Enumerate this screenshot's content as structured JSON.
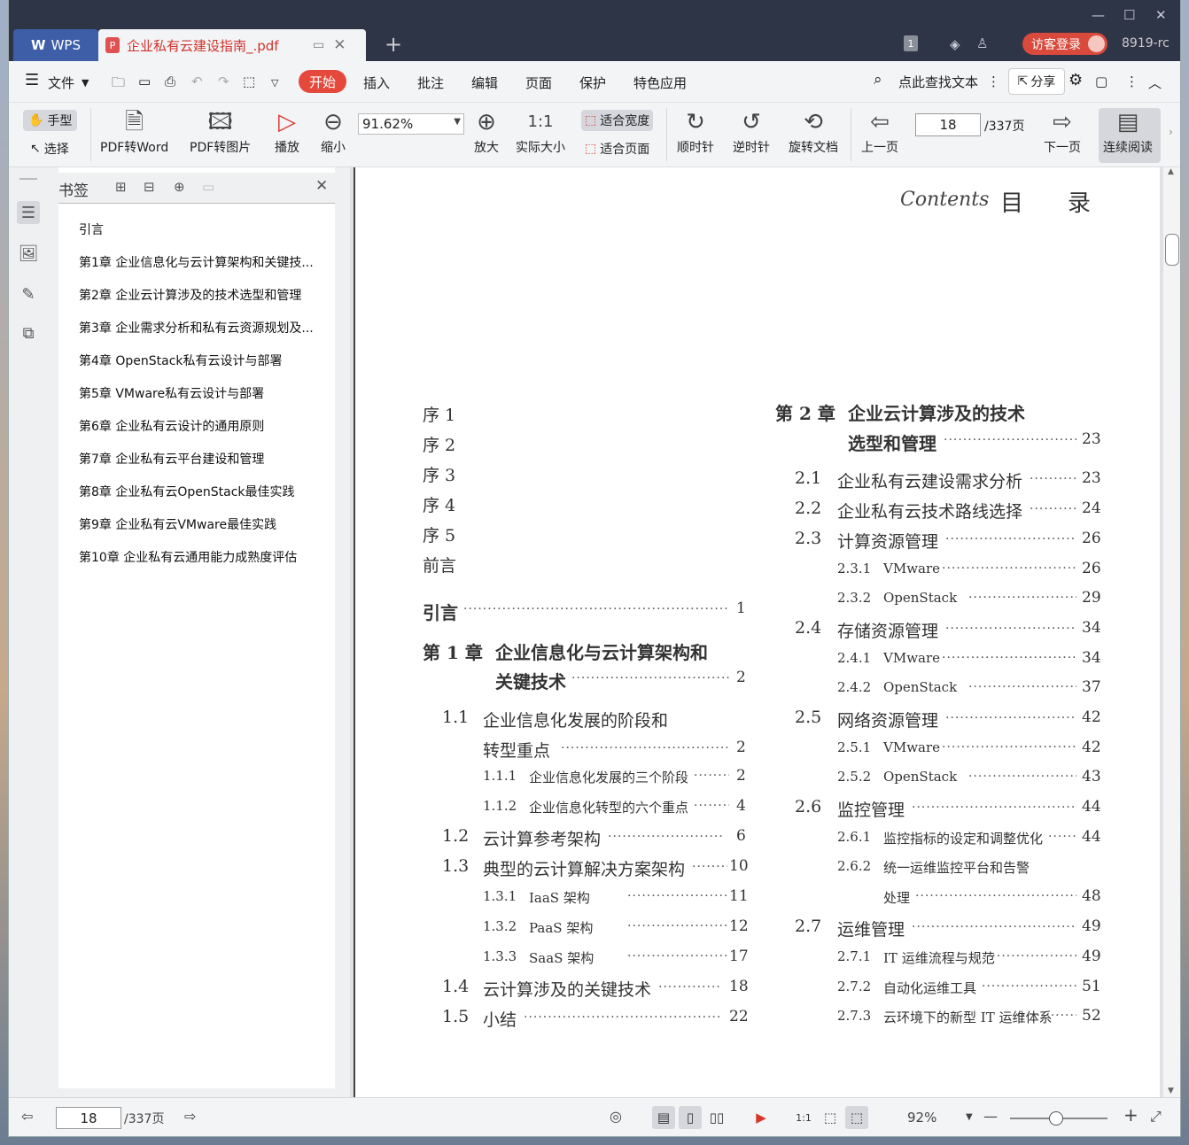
{
  "app": {
    "name": "WPS",
    "user": "8919-rc",
    "login": "访客登录",
    "tab_count": "1"
  },
  "document_tab": {
    "title": "企业私有云建设指南_.pdf"
  },
  "menu": {
    "file": "文件",
    "items": [
      "开始",
      "插入",
      "批注",
      "编辑",
      "页面",
      "保护",
      "特色应用"
    ],
    "search": "点此查找文本",
    "share": "分享"
  },
  "ribbon": {
    "hand": "手型",
    "select": "选择",
    "pdf_to_word": "PDF转Word",
    "pdf_to_image": "PDF转图片",
    "play": "播放",
    "zoom_out": "缩小",
    "zoom_value": "91.62%",
    "zoom_in": "放大",
    "actual_size": "实际大小",
    "fit_width": "适合宽度",
    "fit_page": "适合页面",
    "clockwise": "顺时针",
    "counterclockwise": "逆时针",
    "rotate_doc": "旋转文档",
    "prev_page": "上一页",
    "page_current": "18",
    "page_total": "/337页",
    "next_page": "下一页",
    "continuous": "连续阅读"
  },
  "bookmarks": {
    "title": "书签",
    "items": [
      {
        "label": "引言",
        "expandable": false
      },
      {
        "label": "第1章 企业信息化与云计算架构和关键技...",
        "expandable": true
      },
      {
        "label": "第2章 企业云计算涉及的技术选型和管理",
        "expandable": true
      },
      {
        "label": "第3章 企业需求分析和私有云资源规划及...",
        "expandable": true
      },
      {
        "label": "第4章 OpenStack私有云设计与部署",
        "expandable": true
      },
      {
        "label": "第5章 VMware私有云设计与部署",
        "expandable": true
      },
      {
        "label": "第6章 企业私有云设计的通用原则",
        "expandable": true
      },
      {
        "label": "第7章 企业私有云平台建设和管理",
        "expandable": true
      },
      {
        "label": "第8章 企业私有云OpenStack最佳实践",
        "expandable": true
      },
      {
        "label": "第9章 企业私有云VMware最佳实践",
        "expandable": true
      },
      {
        "label": "第10章 企业私有云通用能力成熟度评估",
        "expandable": true
      }
    ]
  },
  "page_content": {
    "contents_script": "Contents",
    "heading_a": "目",
    "heading_b": "录",
    "left_prefaces": [
      "序 1",
      "序 2",
      "序 3",
      "序 4",
      "序 5",
      "前言"
    ],
    "intro": {
      "label": "引言",
      "page": "1"
    },
    "ch1": {
      "num": "第 1 章",
      "line1": "企业信息化与云计算架构和",
      "line2": "关键技术",
      "page": "2"
    },
    "ch1_entries": [
      {
        "num": "1.1",
        "text": "企业信息化发展的阶段和",
        "text2": "转型重点",
        "page": "2",
        "level": 1
      },
      {
        "num": "1.1.1",
        "text": "企业信息化发展的三个阶段",
        "page": "2",
        "level": 2
      },
      {
        "num": "1.1.2",
        "text": "企业信息化转型的六个重点",
        "page": "4",
        "level": 2
      },
      {
        "num": "1.2",
        "text": "云计算参考架构",
        "page": "6",
        "level": 1
      },
      {
        "num": "1.3",
        "text": "典型的云计算解决方案架构",
        "page": "10",
        "level": 1
      },
      {
        "num": "1.3.1",
        "text": "IaaS 架构",
        "page": "11",
        "level": 2
      },
      {
        "num": "1.3.2",
        "text": "PaaS 架构",
        "page": "12",
        "level": 2
      },
      {
        "num": "1.3.3",
        "text": "SaaS 架构",
        "page": "17",
        "level": 2
      },
      {
        "num": "1.4",
        "text": "云计算涉及的关键技术",
        "page": "18",
        "level": 1
      },
      {
        "num": "1.5",
        "text": "小结",
        "page": "22",
        "level": 1
      }
    ],
    "ch2": {
      "num": "第 2 章",
      "line1": "企业云计算涉及的技术",
      "line2": "选型和管理",
      "page": "23"
    },
    "ch2_entries": [
      {
        "num": "2.1",
        "text": "企业私有云建设需求分析",
        "page": "23",
        "level": 1
      },
      {
        "num": "2.2",
        "text": "企业私有云技术路线选择",
        "page": "24",
        "level": 1
      },
      {
        "num": "2.3",
        "text": "计算资源管理",
        "page": "26",
        "level": 1
      },
      {
        "num": "2.3.1",
        "text": "VMware",
        "page": "26",
        "level": 2
      },
      {
        "num": "2.3.2",
        "text": "OpenStack",
        "page": "29",
        "level": 2
      },
      {
        "num": "2.4",
        "text": "存储资源管理",
        "page": "34",
        "level": 1
      },
      {
        "num": "2.4.1",
        "text": "VMware",
        "page": "34",
        "level": 2
      },
      {
        "num": "2.4.2",
        "text": "OpenStack",
        "page": "37",
        "level": 2
      },
      {
        "num": "2.5",
        "text": "网络资源管理",
        "page": "42",
        "level": 1
      },
      {
        "num": "2.5.1",
        "text": "VMware",
        "page": "42",
        "level": 2
      },
      {
        "num": "2.5.2",
        "text": "OpenStack",
        "page": "43",
        "level": 2
      },
      {
        "num": "2.6",
        "text": "监控管理",
        "page": "44",
        "level": 1
      },
      {
        "num": "2.6.1",
        "text": "监控指标的设定和调整优化",
        "page": "44",
        "level": 2
      },
      {
        "num": "2.6.2",
        "text": "统一运维监控平台和告警",
        "text2": "处理",
        "page": "48",
        "level": 2
      },
      {
        "num": "2.7",
        "text": "运维管理",
        "page": "49",
        "level": 1
      },
      {
        "num": "2.7.1",
        "text": "IT 运维流程与规范",
        "page": "49",
        "level": 2
      },
      {
        "num": "2.7.2",
        "text": "自动化运维工具",
        "page": "51",
        "level": 2
      },
      {
        "num": "2.7.3",
        "text": "云环境下的新型 IT 运维体系",
        "page": "52",
        "level": 2
      }
    ]
  },
  "status": {
    "page_current": "18",
    "page_total": "/337页",
    "zoom": "92%"
  }
}
